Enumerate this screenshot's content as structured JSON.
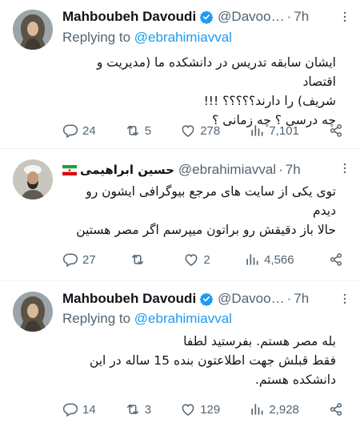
{
  "tweets": [
    {
      "name": "Mahboubeh Davoudi",
      "handle": "@Davoo…",
      "time": "7h",
      "replying_prefix": "Replying to",
      "replying_to": "@ebrahimiavval",
      "lines": [
        "ایشان سابقه تدریس در دانشکده ما (مدیریت و اقتصاد",
        "شریف) را دارند؟؟؟؟؟ !!!",
        "چه درسی ؟ چه زمانی ؟"
      ],
      "replies": "24",
      "retweets": "5",
      "likes": "278",
      "views": "7,101",
      "icons": [
        "verified-badge-icon",
        "more-icon",
        "reply-icon",
        "retweet-icon",
        "like-icon",
        "views-icon",
        "share-icon"
      ]
    },
    {
      "name": "حسین ابراهیمی",
      "handle": "@ebrahimiavval",
      "time": "7h",
      "lines": [
        "توی یکی از سایت های مرجع بیوگرافی ایشون رو",
        "دیدم",
        "حالا باز دقیقش رو براتون میپرسم اگر مصر هستین"
      ],
      "replies": "27",
      "retweets": "",
      "likes": "2",
      "views": "4,566",
      "icons": [
        "iran-flag-icon",
        "more-icon",
        "reply-icon",
        "retweet-icon",
        "like-icon",
        "views-icon",
        "share-icon"
      ]
    },
    {
      "name": "Mahboubeh Davoudi",
      "handle": "@Davoo…",
      "time": "7h",
      "replying_prefix": "Replying to",
      "replying_to": "@ebrahimiavval",
      "lines": [
        "بله مصر هستم. بفرستید لطفا",
        "فقط قبلش جهت اطلاعتون بنده 15 ساله در این",
        "دانشکده هستم."
      ],
      "replies": "14",
      "retweets": "3",
      "likes": "129",
      "views": "2,928",
      "icons": [
        "verified-badge-icon",
        "more-icon",
        "reply-icon",
        "retweet-icon",
        "like-icon",
        "views-icon",
        "share-icon"
      ]
    }
  ],
  "colors": {
    "text": "#0f1419",
    "muted": "#536471",
    "link": "#1d9bf0",
    "verified": "#1d9bf0",
    "divider": "#eff3f4"
  }
}
